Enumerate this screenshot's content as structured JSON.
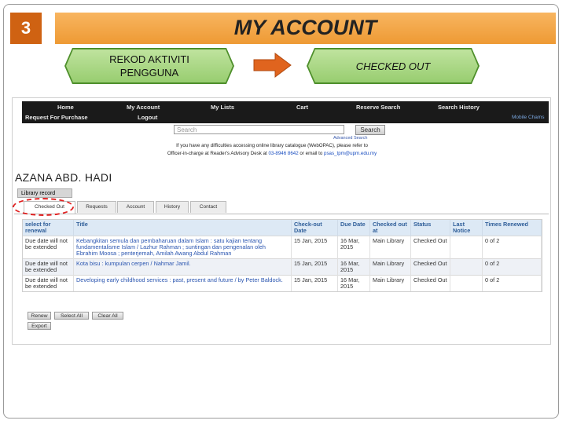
{
  "slide": {
    "number": "3",
    "title": "MY ACCOUNT",
    "step_left_line1": "REKOD AKTIVITI",
    "step_left_line2": "PENGGUNA",
    "step_right": "CHECKED OUT"
  },
  "opac": {
    "nav": {
      "home": "Home",
      "my_account": "My Account",
      "my_lists": "My Lists",
      "cart": "Cart",
      "reserve_search": "Reserve Search",
      "search_history": "Search History",
      "request_purchase": "Request For Purchase",
      "logout": "Logout",
      "mobile": "Mobile Chams"
    },
    "search": {
      "placeholder": "Search",
      "button": "Search",
      "advanced": "Advanced Search"
    },
    "help": {
      "line1": "If you have any difficulties accessing online library catalogue (WebOPAC), please refer to",
      "line2_a": "Officer-in-charge at Reader's Advisory Desk at ",
      "phone": "03-8946 8642",
      "line2_b": " or email to ",
      "email": "psas_tpm@upm.edu.my"
    },
    "user_name": "AZANA ABD. HADI",
    "library_record": "Library record",
    "tabs": [
      "Checked Out",
      "Requests",
      "Account",
      "History",
      "Contact"
    ],
    "table": {
      "headers": [
        "select for renewal",
        "Title",
        "Check-out Date",
        "Due Date",
        "Checked out at",
        "Status",
        "Last Notice",
        "Times Renewed"
      ],
      "rows": [
        {
          "renew": "Due date will not be extended",
          "title": "Kebangkitan semula dan pembaharuan dalam Islam : satu kajian tentang fundamentalisme Islam / Lazhur Rahman ; suntingan dan pengenalan oleh Ebrahim Moosa ; penterjemah, Amilah Awang Abdul Rahman",
          "checkout": "15 Jan, 2015",
          "due": "16 Mar, 2015",
          "at": "Main Library",
          "status": "Checked Out",
          "notice": "",
          "renewed": "0 of 2"
        },
        {
          "renew": "Due date will not be extended",
          "title": "Kota bisu : kumpulan cerpen / Nahmar Jamil.",
          "checkout": "15 Jan, 2015",
          "due": "16 Mar, 2015",
          "at": "Main Library",
          "status": "Checked Out",
          "notice": "",
          "renewed": "0 of 2"
        },
        {
          "renew": "Due date will not be extended",
          "title": "Developing early childhood services : past, present and future / by Peter Baldock.",
          "checkout": "15 Jan, 2015",
          "due": "16 Mar, 2015",
          "at": "Main Library",
          "status": "Checked Out",
          "notice": "",
          "renewed": "0 of 2"
        }
      ]
    },
    "buttons": {
      "renew": "Renew",
      "select_all": "Select All",
      "clear_all": "Clear All",
      "export": "Export"
    }
  },
  "colors": {
    "accent_orange": "#cf6212",
    "title_bar": "#f5a94d",
    "step_green": "#a5d67c",
    "arrow": "#e0641e"
  }
}
